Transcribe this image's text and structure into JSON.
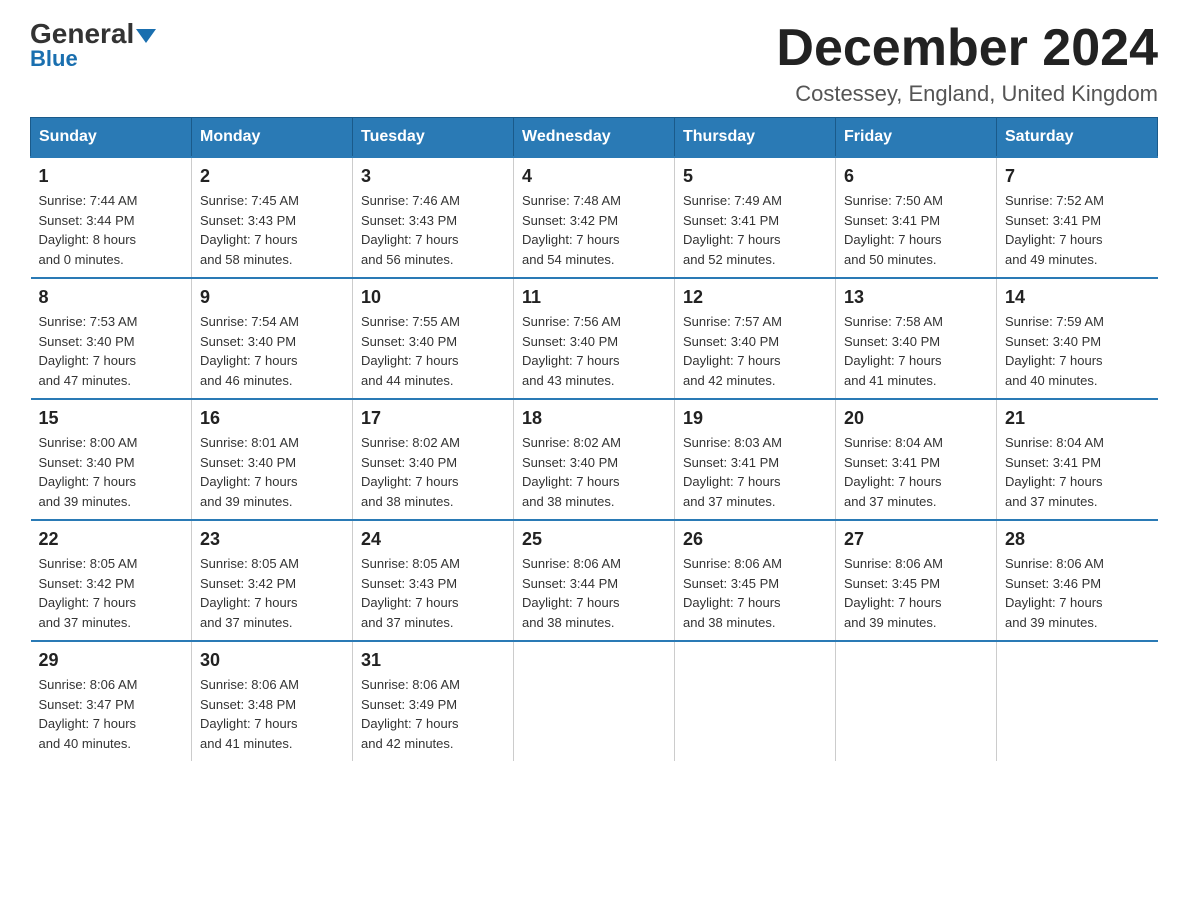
{
  "header": {
    "logo_general": "General",
    "logo_blue": "Blue",
    "title": "December 2024",
    "subtitle": "Costessey, England, United Kingdom"
  },
  "weekdays": [
    "Sunday",
    "Monday",
    "Tuesday",
    "Wednesday",
    "Thursday",
    "Friday",
    "Saturday"
  ],
  "weeks": [
    [
      {
        "day": "1",
        "sunrise": "7:44 AM",
        "sunset": "3:44 PM",
        "daylight": "8 hours and 0 minutes."
      },
      {
        "day": "2",
        "sunrise": "7:45 AM",
        "sunset": "3:43 PM",
        "daylight": "7 hours and 58 minutes."
      },
      {
        "day": "3",
        "sunrise": "7:46 AM",
        "sunset": "3:43 PM",
        "daylight": "7 hours and 56 minutes."
      },
      {
        "day": "4",
        "sunrise": "7:48 AM",
        "sunset": "3:42 PM",
        "daylight": "7 hours and 54 minutes."
      },
      {
        "day": "5",
        "sunrise": "7:49 AM",
        "sunset": "3:41 PM",
        "daylight": "7 hours and 52 minutes."
      },
      {
        "day": "6",
        "sunrise": "7:50 AM",
        "sunset": "3:41 PM",
        "daylight": "7 hours and 50 minutes."
      },
      {
        "day": "7",
        "sunrise": "7:52 AM",
        "sunset": "3:41 PM",
        "daylight": "7 hours and 49 minutes."
      }
    ],
    [
      {
        "day": "8",
        "sunrise": "7:53 AM",
        "sunset": "3:40 PM",
        "daylight": "7 hours and 47 minutes."
      },
      {
        "day": "9",
        "sunrise": "7:54 AM",
        "sunset": "3:40 PM",
        "daylight": "7 hours and 46 minutes."
      },
      {
        "day": "10",
        "sunrise": "7:55 AM",
        "sunset": "3:40 PM",
        "daylight": "7 hours and 44 minutes."
      },
      {
        "day": "11",
        "sunrise": "7:56 AM",
        "sunset": "3:40 PM",
        "daylight": "7 hours and 43 minutes."
      },
      {
        "day": "12",
        "sunrise": "7:57 AM",
        "sunset": "3:40 PM",
        "daylight": "7 hours and 42 minutes."
      },
      {
        "day": "13",
        "sunrise": "7:58 AM",
        "sunset": "3:40 PM",
        "daylight": "7 hours and 41 minutes."
      },
      {
        "day": "14",
        "sunrise": "7:59 AM",
        "sunset": "3:40 PM",
        "daylight": "7 hours and 40 minutes."
      }
    ],
    [
      {
        "day": "15",
        "sunrise": "8:00 AM",
        "sunset": "3:40 PM",
        "daylight": "7 hours and 39 minutes."
      },
      {
        "day": "16",
        "sunrise": "8:01 AM",
        "sunset": "3:40 PM",
        "daylight": "7 hours and 39 minutes."
      },
      {
        "day": "17",
        "sunrise": "8:02 AM",
        "sunset": "3:40 PM",
        "daylight": "7 hours and 38 minutes."
      },
      {
        "day": "18",
        "sunrise": "8:02 AM",
        "sunset": "3:40 PM",
        "daylight": "7 hours and 38 minutes."
      },
      {
        "day": "19",
        "sunrise": "8:03 AM",
        "sunset": "3:41 PM",
        "daylight": "7 hours and 37 minutes."
      },
      {
        "day": "20",
        "sunrise": "8:04 AM",
        "sunset": "3:41 PM",
        "daylight": "7 hours and 37 minutes."
      },
      {
        "day": "21",
        "sunrise": "8:04 AM",
        "sunset": "3:41 PM",
        "daylight": "7 hours and 37 minutes."
      }
    ],
    [
      {
        "day": "22",
        "sunrise": "8:05 AM",
        "sunset": "3:42 PM",
        "daylight": "7 hours and 37 minutes."
      },
      {
        "day": "23",
        "sunrise": "8:05 AM",
        "sunset": "3:42 PM",
        "daylight": "7 hours and 37 minutes."
      },
      {
        "day": "24",
        "sunrise": "8:05 AM",
        "sunset": "3:43 PM",
        "daylight": "7 hours and 37 minutes."
      },
      {
        "day": "25",
        "sunrise": "8:06 AM",
        "sunset": "3:44 PM",
        "daylight": "7 hours and 38 minutes."
      },
      {
        "day": "26",
        "sunrise": "8:06 AM",
        "sunset": "3:45 PM",
        "daylight": "7 hours and 38 minutes."
      },
      {
        "day": "27",
        "sunrise": "8:06 AM",
        "sunset": "3:45 PM",
        "daylight": "7 hours and 39 minutes."
      },
      {
        "day": "28",
        "sunrise": "8:06 AM",
        "sunset": "3:46 PM",
        "daylight": "7 hours and 39 minutes."
      }
    ],
    [
      {
        "day": "29",
        "sunrise": "8:06 AM",
        "sunset": "3:47 PM",
        "daylight": "7 hours and 40 minutes."
      },
      {
        "day": "30",
        "sunrise": "8:06 AM",
        "sunset": "3:48 PM",
        "daylight": "7 hours and 41 minutes."
      },
      {
        "day": "31",
        "sunrise": "8:06 AM",
        "sunset": "3:49 PM",
        "daylight": "7 hours and 42 minutes."
      },
      null,
      null,
      null,
      null
    ]
  ]
}
